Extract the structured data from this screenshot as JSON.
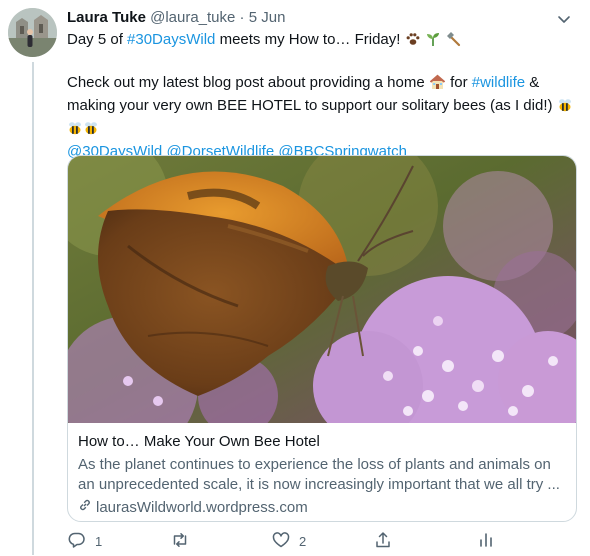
{
  "tweet": {
    "author": {
      "name": "Laura Tuke",
      "handle": "@laura_tuke",
      "separator": "·",
      "date": "5 Jun"
    },
    "line1": {
      "a": "Day 5 of ",
      "hashtag1": "#30DaysWild",
      "b": " meets my How to… Friday!"
    },
    "line2": {
      "a": "Check out my latest blog post about providing a home",
      "b": "for",
      "hashtag2": "#wildlife",
      "c": "&",
      "d": "making your very own BEE HOTEL to support our solitary bees (as I did!)"
    },
    "mentions": {
      "m1": "@30DaysWild",
      "m2": "@DorsetWildlife",
      "m3": "@BBCSpringwatch"
    },
    "emojis": [
      "paw-prints",
      "seedling",
      "hammer",
      "house",
      "bee",
      "bee",
      "bee"
    ]
  },
  "card": {
    "title": "How to… Make Your Own Bee Hotel",
    "description": "As the planet continues to experience the loss of plants and animals on an unprecedented scale, it is now increasingly important that we all try ...",
    "domain": "laurasWildworld.wordpress.com"
  },
  "actions": {
    "reply_count": "1",
    "retweet_count": "",
    "like_count": "2"
  },
  "colors": {
    "link": "#1b95e0",
    "secondary": "#536471",
    "border": "#cfd9de"
  }
}
